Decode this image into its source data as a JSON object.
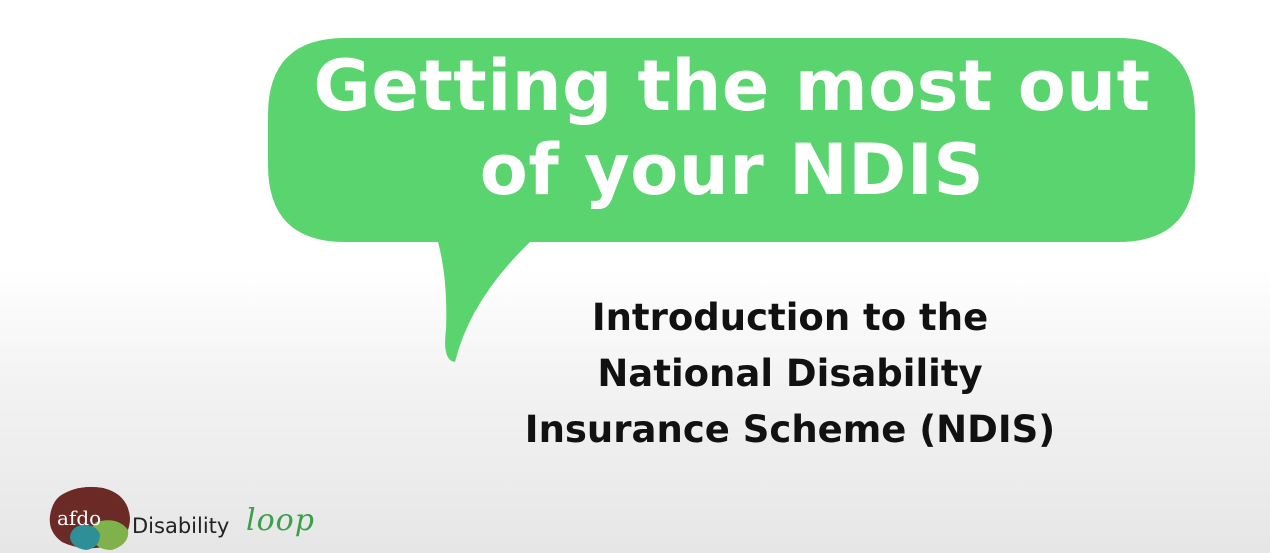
{
  "slide": {
    "title_lines": [
      "Getting the most out",
      "of your NDIS"
    ],
    "subtitle_lines": [
      "Introduction to the",
      "National Disability",
      "Insurance Scheme (NDIS)"
    ]
  },
  "logo": {
    "afdo": "afdo",
    "disability": "Disability",
    "loop": "loop"
  },
  "colors": {
    "bubble": "#5ad46e",
    "title_text": "#ffffff",
    "subtitle_text": "#111111",
    "logo_loop": "#3aa04a"
  }
}
